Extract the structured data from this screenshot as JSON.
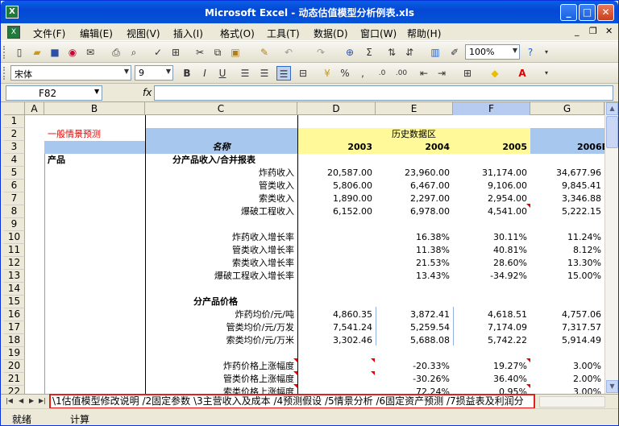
{
  "window": {
    "title": "Microsoft Excel - 动态估值模型分析例表.xls",
    "app_icon": "X"
  },
  "menu": [
    "文件(F)",
    "编辑(E)",
    "视图(V)",
    "插入(I)",
    "格式(O)",
    "工具(T)",
    "数据(D)",
    "窗口(W)",
    "帮助(H)"
  ],
  "toolbar": {
    "zoom": "100%"
  },
  "format": {
    "font": "宋体",
    "size": "9"
  },
  "formula": {
    "namebox": "F82",
    "fx": "fx",
    "content": ""
  },
  "columns": [
    "A",
    "B",
    "C",
    "D",
    "E",
    "F",
    "G"
  ],
  "rows": [
    "1",
    "2",
    "3",
    "4",
    "5",
    "6",
    "7",
    "8",
    "9",
    "10",
    "11",
    "12",
    "13",
    "14",
    "15",
    "16",
    "17",
    "18",
    "19",
    "20",
    "21",
    "22"
  ],
  "sheet": {
    "b2": "一般情景预测",
    "hist_label": "历史数据区",
    "c3": "名称",
    "years": [
      "2003",
      "2004",
      "2005",
      "2006E"
    ],
    "b4": "产品",
    "c4": "分产品收入/合并报表",
    "c15": "分产品价格",
    "data_rows": [
      {
        "label": "炸药收入",
        "d": "20,587.00",
        "e": "23,960.00",
        "f": "31,174.00",
        "g": "34,677.96"
      },
      {
        "label": "管类收入",
        "d": "5,806.00",
        "e": "6,467.00",
        "f": "9,106.00",
        "g": "9,845.41"
      },
      {
        "label": "索类收入",
        "d": "1,890.00",
        "e": "2,297.00",
        "f": "2,954.00",
        "g": "3,346.88"
      },
      {
        "label": "爆破工程收入",
        "d": "6,152.00",
        "e": "6,978.00",
        "f": "4,541.00",
        "g": "5,222.15"
      },
      {
        "label": "",
        "d": "",
        "e": "",
        "f": "",
        "g": ""
      },
      {
        "label": "炸药收入增长率",
        "d": "",
        "e": "16.38%",
        "f": "30.11%",
        "g": "11.24%"
      },
      {
        "label": "管类收入增长率",
        "d": "",
        "e": "11.38%",
        "f": "40.81%",
        "g": "8.12%"
      },
      {
        "label": "索类收入增长率",
        "d": "",
        "e": "21.53%",
        "f": "28.60%",
        "g": "13.30%"
      },
      {
        "label": "爆破工程收入增长率",
        "d": "",
        "e": "13.43%",
        "f": "-34.92%",
        "g": "15.00%"
      },
      {
        "label": "",
        "d": "",
        "e": "",
        "f": "",
        "g": ""
      },
      {
        "label": "",
        "d": "",
        "e": "",
        "f": "",
        "g": ""
      },
      {
        "label": "炸药均价/元/吨",
        "d": "4,860.35",
        "e": "3,872.41",
        "f": "4,618.51",
        "g": "4,757.06"
      },
      {
        "label": "管类均价/元/万发",
        "d": "7,541.24",
        "e": "5,259.54",
        "f": "7,174.09",
        "g": "7,317.57"
      },
      {
        "label": "索类均价/元/万米",
        "d": "3,302.46",
        "e": "5,688.08",
        "f": "5,742.22",
        "g": "5,914.49"
      },
      {
        "label": "",
        "d": "",
        "e": "",
        "f": "",
        "g": ""
      },
      {
        "label": "炸药价格上涨幅度",
        "d": "",
        "e": "-20.33%",
        "f": "19.27%",
        "g": "3.00%"
      },
      {
        "label": "管类价格上涨幅度",
        "d": "",
        "e": "-30.26%",
        "f": "36.40%",
        "g": "2.00%"
      },
      {
        "label": "索类价格上涨幅度",
        "d": "",
        "e": "72.24%",
        "f": "0.95%",
        "g": "3.00%"
      }
    ]
  },
  "tabs_text": "\\1估值模型修改说明 /2固定参数 \\3主营收入及成本 /4预测假设 /5情景分析 /6固定资产预测 /7损益表及利润分",
  "status": {
    "ready": "就绪",
    "calc": "计算"
  }
}
